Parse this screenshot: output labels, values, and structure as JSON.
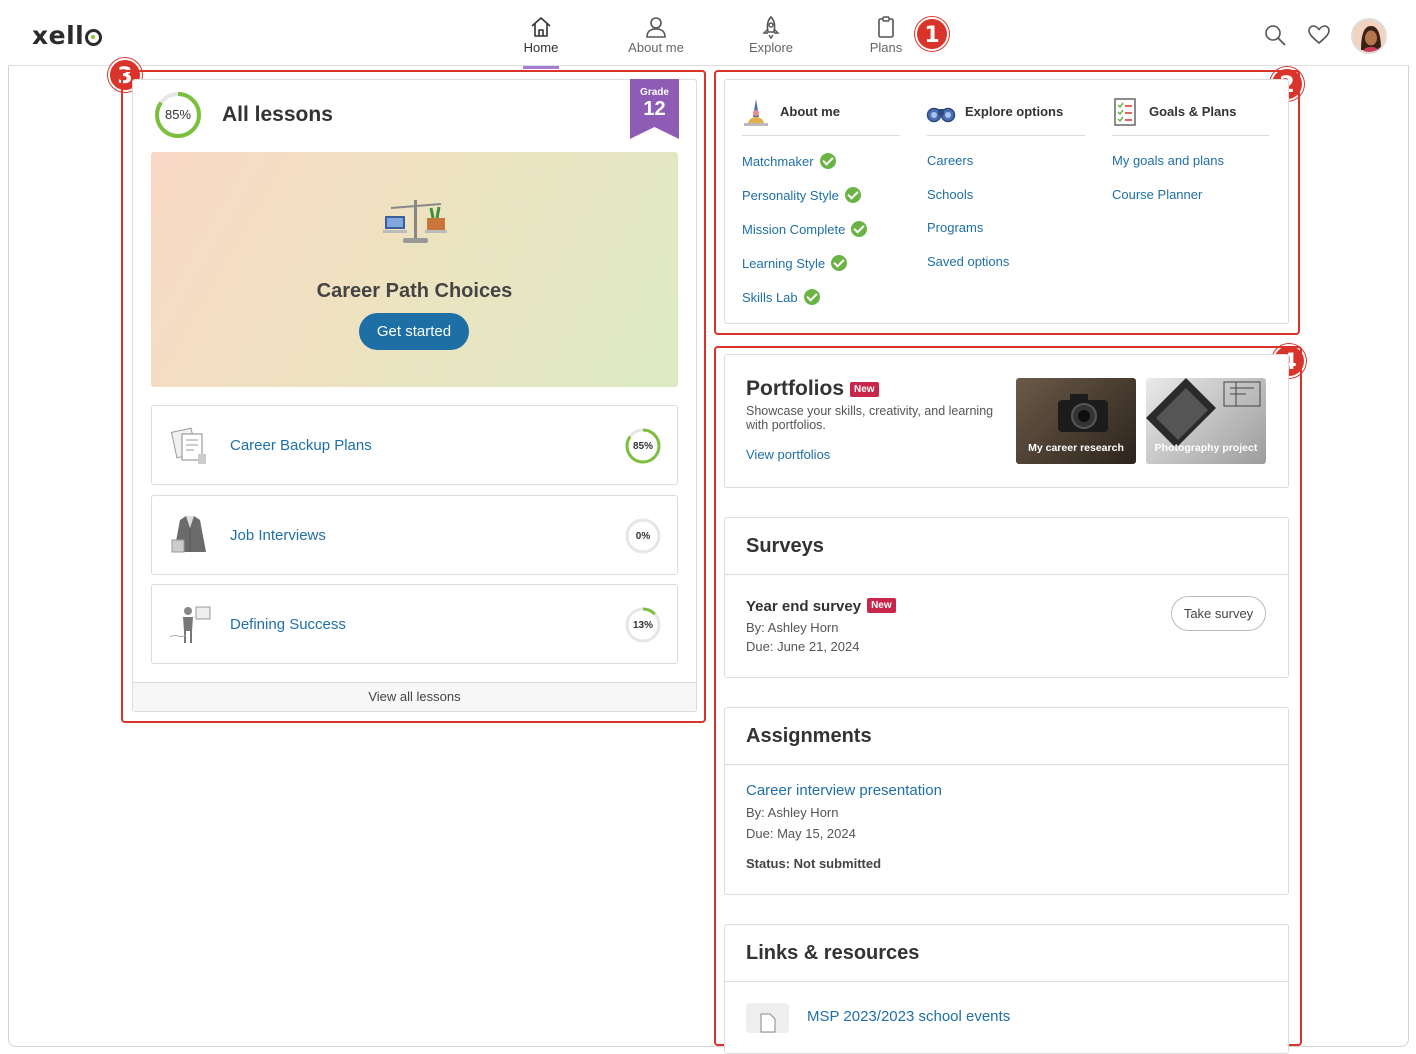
{
  "brand": {
    "logo_text": "xell"
  },
  "nav": {
    "items": [
      {
        "label": "Home",
        "icon": "home-icon"
      },
      {
        "label": "About me",
        "icon": "person-icon"
      },
      {
        "label": "Explore",
        "icon": "rocket-icon"
      },
      {
        "label": "Plans",
        "icon": "clipboard-icon"
      }
    ],
    "active": "Home"
  },
  "header_icons": [
    "search-icon",
    "heart-icon",
    "avatar"
  ],
  "annotations": [
    "1",
    "2",
    "3",
    "4"
  ],
  "lessons": {
    "title": "All lessons",
    "progress_label": "85%",
    "progress": 0.85,
    "grade_label": "Grade",
    "grade_value": "12",
    "featured": {
      "title": "Career Path Choices",
      "button": "Get started"
    },
    "rows": [
      {
        "name": "Career Backup Plans",
        "progress_label": "85%",
        "progress": 0.85
      },
      {
        "name": "Job Interviews",
        "progress_label": "0%",
        "progress": 0
      },
      {
        "name": "Defining Success",
        "progress_label": "13%",
        "progress": 0.13
      }
    ],
    "view_all": "View all lessons"
  },
  "quicklinks": {
    "about": {
      "title": "About me",
      "items": [
        "Matchmaker",
        "Personality Style",
        "Mission Complete",
        "Learning Style",
        "Skills Lab"
      ]
    },
    "explore": {
      "title": "Explore options",
      "items": [
        "Careers",
        "Schools",
        "Programs",
        "Saved options"
      ]
    },
    "goals": {
      "title": "Goals & Plans",
      "items": [
        "My goals and plans",
        "Course Planner"
      ]
    }
  },
  "portfolios": {
    "title": "Portfolios",
    "new_tag": "New",
    "desc_line1": "Showcase your skills, creativity, and learning",
    "desc_line2": "with portfolios.",
    "link": "View portfolios",
    "thumbs": [
      "My career research",
      "Photography project"
    ]
  },
  "surveys": {
    "title": "Surveys",
    "item_title": "Year end survey",
    "new_tag": "New",
    "by": "By: Ashley Horn",
    "due": "Due: June 21, 2024",
    "button": "Take survey"
  },
  "assignments": {
    "title": "Assignments",
    "item_title": "Career interview presentation",
    "by": "By: Ashley Horn",
    "due": "Due: May 15, 2024",
    "status": "Status: Not submitted"
  },
  "links": {
    "title": "Links & resources",
    "item": "MSP 2023/2023 school events"
  },
  "colors": {
    "accent_purple": "#8e5bb5",
    "link_blue": "#1f6fa8",
    "progress_green": "#7cbf3f",
    "annotation_red": "#d9332a",
    "new_tag": "#c8264a"
  }
}
